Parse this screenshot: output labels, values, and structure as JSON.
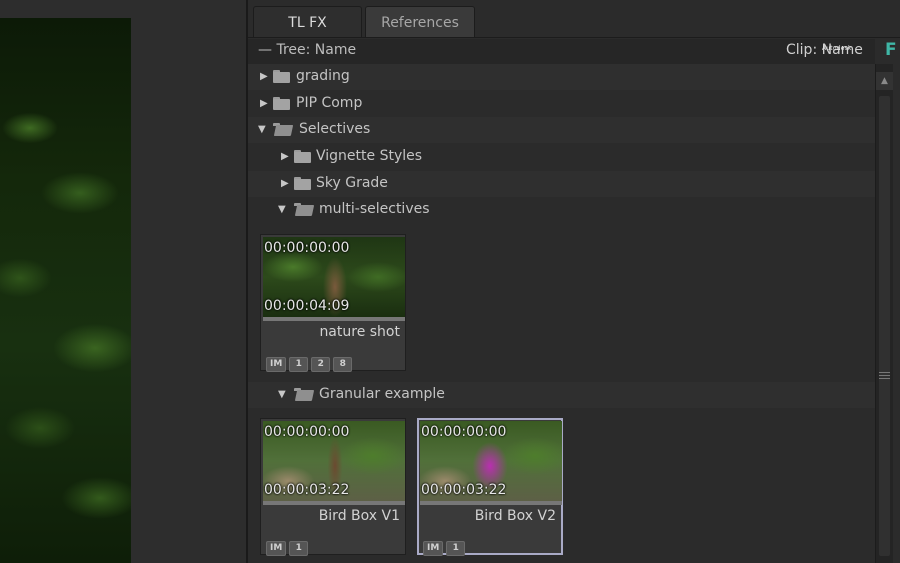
{
  "tabs": [
    {
      "label": "TL FX",
      "active": true
    },
    {
      "label": "References",
      "active": false
    }
  ],
  "header": {
    "tree_label": "— Tree: Name",
    "clip_label": "Clip: Name",
    "autodesk_text": "Autodesk",
    "f_logo": "F"
  },
  "tree": [
    {
      "label": "grading",
      "expanded": false
    },
    {
      "label": "PIP Comp",
      "expanded": false
    },
    {
      "label": "Selectives",
      "expanded": true
    },
    {
      "label": "Vignette Styles",
      "expanded": false
    },
    {
      "label": "Sky Grade",
      "expanded": false
    },
    {
      "label": "multi-selectives",
      "expanded": true
    },
    {
      "label": "Granular example",
      "expanded": true
    }
  ],
  "clips": [
    {
      "name": "nature shot",
      "tc_in": "00:00:00:00",
      "tc_out": "00:00:04:09",
      "badges": [
        "IM",
        "1",
        "2",
        "8"
      ],
      "selected": false
    },
    {
      "name": "Bird Box V1",
      "tc_in": "00:00:00:00",
      "tc_out": "00:00:03:22",
      "badges": [
        "IM",
        "1"
      ],
      "selected": false
    },
    {
      "name": "Bird Box V2",
      "tc_in": "00:00:00:00",
      "tc_out": "00:00:03:22",
      "badges": [
        "IM",
        "1"
      ],
      "selected": true
    }
  ],
  "icons": {
    "collapsed": "triangle-right-icon",
    "expanded": "triangle-down-icon",
    "folder": "folder-icon",
    "scroll_up": "scroll-up-arrow-icon"
  },
  "colors": {
    "panel_bg": "#2b2b2b",
    "selected_border": "#a9aac6",
    "logo_accent": "#3fb7a6"
  }
}
